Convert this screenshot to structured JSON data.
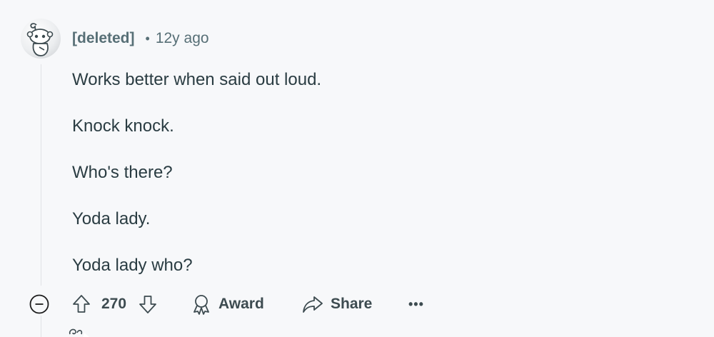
{
  "comment": {
    "author": "[deleted]",
    "separator": "•",
    "age": "12y ago",
    "paragraphs": [
      "Works better when said out loud.",
      "Knock knock.",
      "Who's there?",
      "Yoda lady.",
      "Yoda lady who?"
    ]
  },
  "actions": {
    "collapse_icon": "minus-circle-icon",
    "upvote_icon": "upvote-arrow-icon",
    "score": "270",
    "downvote_icon": "downvote-arrow-icon",
    "award_label": "Award",
    "award_icon": "award-ribbon-icon",
    "share_label": "Share",
    "share_icon": "share-arrow-icon",
    "more_label": "•••"
  },
  "colors": {
    "background": "#f7f8fa",
    "meta_text": "#576f76",
    "body_text": "#2a3c42",
    "thread_line": "#e1e3e6"
  }
}
